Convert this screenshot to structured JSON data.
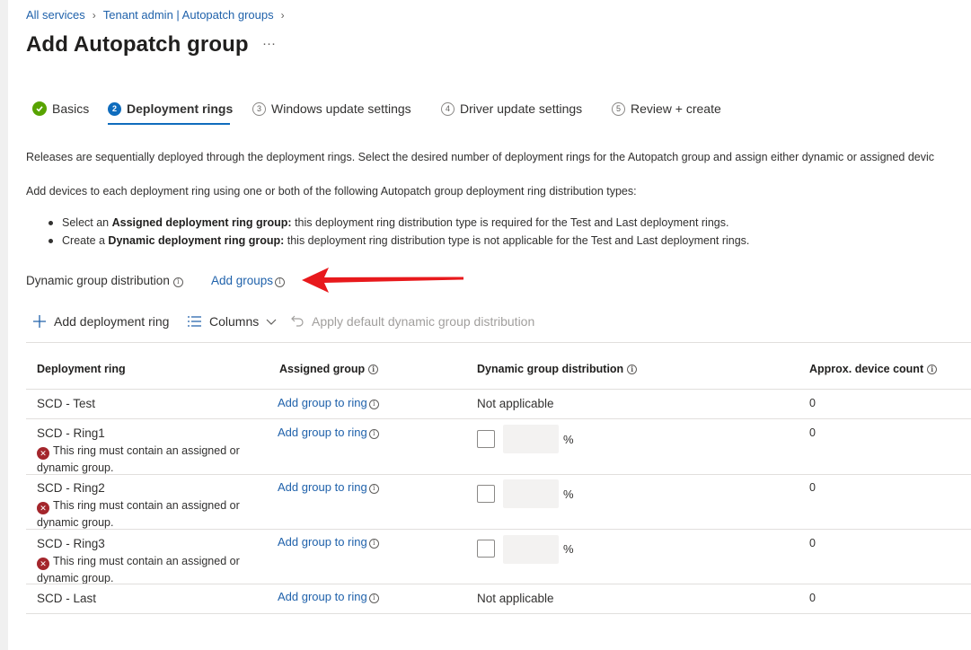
{
  "breadcrumb": {
    "items": [
      "All services",
      "Tenant admin | Autopatch groups"
    ]
  },
  "page": {
    "title": "Add Autopatch group",
    "more": "···"
  },
  "tabs": [
    {
      "label": "Basics",
      "state": "complete"
    },
    {
      "label": "Deployment rings",
      "step": "2",
      "state": "active"
    },
    {
      "label": "Windows update settings",
      "step": "3",
      "state": "pending"
    },
    {
      "label": "Driver update settings",
      "step": "4",
      "state": "pending"
    },
    {
      "label": "Review + create",
      "step": "5",
      "state": "pending"
    }
  ],
  "intro": {
    "p1": "Releases are sequentially deployed through the deployment rings. Select the desired number of deployment rings for the Autopatch group and assign either dynamic or assigned devic",
    "p2": "Add devices to each deployment ring using one or both of the following Autopatch group deployment ring distribution types:",
    "bullet1": {
      "pre": "Select an ",
      "bold": "Assigned deployment ring group:",
      "post": " this deployment ring distribution type is required for the Test and Last deployment rings."
    },
    "bullet2": {
      "pre": "Create a ",
      "bold": "Dynamic deployment ring group:",
      "post": " this deployment ring distribution type is not applicable for the Test and Last deployment rings."
    }
  },
  "dynamic_distribution": {
    "label": "Dynamic group distribution",
    "add_groups": "Add groups"
  },
  "toolbar": {
    "add_ring": "Add deployment ring",
    "columns": "Columns",
    "apply_default": "Apply default dynamic group distribution"
  },
  "table": {
    "headers": [
      "Deployment ring",
      "Assigned group",
      "Dynamic group distribution",
      "Approx. device count"
    ],
    "rows": [
      {
        "ring": "SCD - Test",
        "assigned": "Add group to ring",
        "dynamic": "Not applicable",
        "count": "0",
        "error": ""
      },
      {
        "ring": "SCD - Ring1",
        "assigned": "Add group to ring",
        "dynamic": "%",
        "count": "0",
        "error": "This ring must contain an assigned or dynamic group."
      },
      {
        "ring": "SCD - Ring2",
        "assigned": "Add group to ring",
        "dynamic": "%",
        "count": "0",
        "error": "This ring must contain an assigned or dynamic group."
      },
      {
        "ring": "SCD - Ring3",
        "assigned": "Add group to ring",
        "dynamic": "%",
        "count": "0",
        "error": "This ring must contain an assigned or dynamic group."
      },
      {
        "ring": "SCD - Last",
        "assigned": "Add group to ring",
        "dynamic": "Not applicable",
        "count": "0",
        "error": ""
      }
    ]
  },
  "annotation": {
    "arrow_color": "#e8191c"
  },
  "colors": {
    "link": "#2062ab",
    "accent": "#0f6cbd",
    "success": "#57a300",
    "error": "#a4262c"
  }
}
